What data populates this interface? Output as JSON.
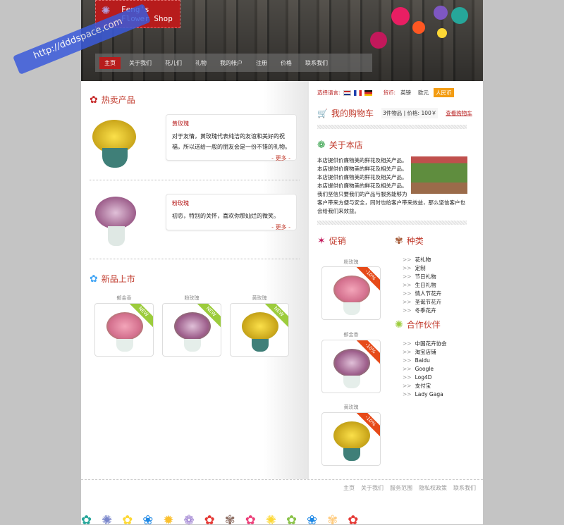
{
  "watermark": "http://dddspace.com",
  "logo": {
    "line1": "Feng's",
    "line2": "Flower Shop"
  },
  "nav": [
    "主页",
    "关于我们",
    "花儿们",
    "礼物",
    "我的帐户",
    "注册",
    "价格",
    "联系我们"
  ],
  "hot": {
    "title": "热卖产品",
    "items": [
      {
        "name": "黄玫瑰",
        "desc": "对于友情，黄玫瑰代表纯洁的友谊和美好的祝福，所以送给一般的朋友会是一份不错的礼物。",
        "more": "- 更多 -"
      },
      {
        "name": "粉玫瑰",
        "desc": "初恋，特别的关怀，喜欢你那灿烂的微笑。",
        "more": "- 更多 -"
      }
    ]
  },
  "new": {
    "title": "新品上市",
    "badge": "NEW",
    "items": [
      "郁金香",
      "粉玫瑰",
      "黄玫瑰"
    ]
  },
  "lang": {
    "label": "选择语言:",
    "currency_label": "货币:",
    "currencies": [
      "英镑",
      "欧元",
      "人民币"
    ]
  },
  "cart": {
    "title": "我的购物车",
    "summary": "3件物品 | 价格: 100￥",
    "view": "查看购物车"
  },
  "about": {
    "title": "关于本店",
    "text": "本店提供价廉物美的鲜花及相关产品。本店提供价廉物美的鲜花及相关产品。本店提供价廉物美的鲜花及相关产品。本店提供价廉物美的鲜花及相关产品。我们坚信只要我们的产品与服务能够为客户带来方便与安全，同时也给客户带来效益，那么坚信客户也会给我们来效益。"
  },
  "promo": {
    "title": "促销",
    "badge": "-10%",
    "items": [
      "粉玫瑰",
      "郁金香",
      "黄玫瑰"
    ]
  },
  "categories": {
    "title": "种类",
    "items": [
      "花礼物",
      "定制",
      "节日礼物",
      "生日礼物",
      "情人节花卉",
      "圣诞节花卉",
      "冬季花卉"
    ]
  },
  "partners": {
    "title": "合作伙伴",
    "items": [
      "中国花卉协会",
      "淘宝店铺",
      "Baidu",
      "Google",
      "Log4D",
      "支付宝",
      "Lady Gaga"
    ]
  },
  "footer": [
    "主页",
    "关于我们",
    "服务范围",
    "隐私权政策",
    "联系我们"
  ],
  "colors": {
    "accent": "#b71c1c",
    "orange": "#f39c12",
    "new": "#9ccc3c"
  }
}
